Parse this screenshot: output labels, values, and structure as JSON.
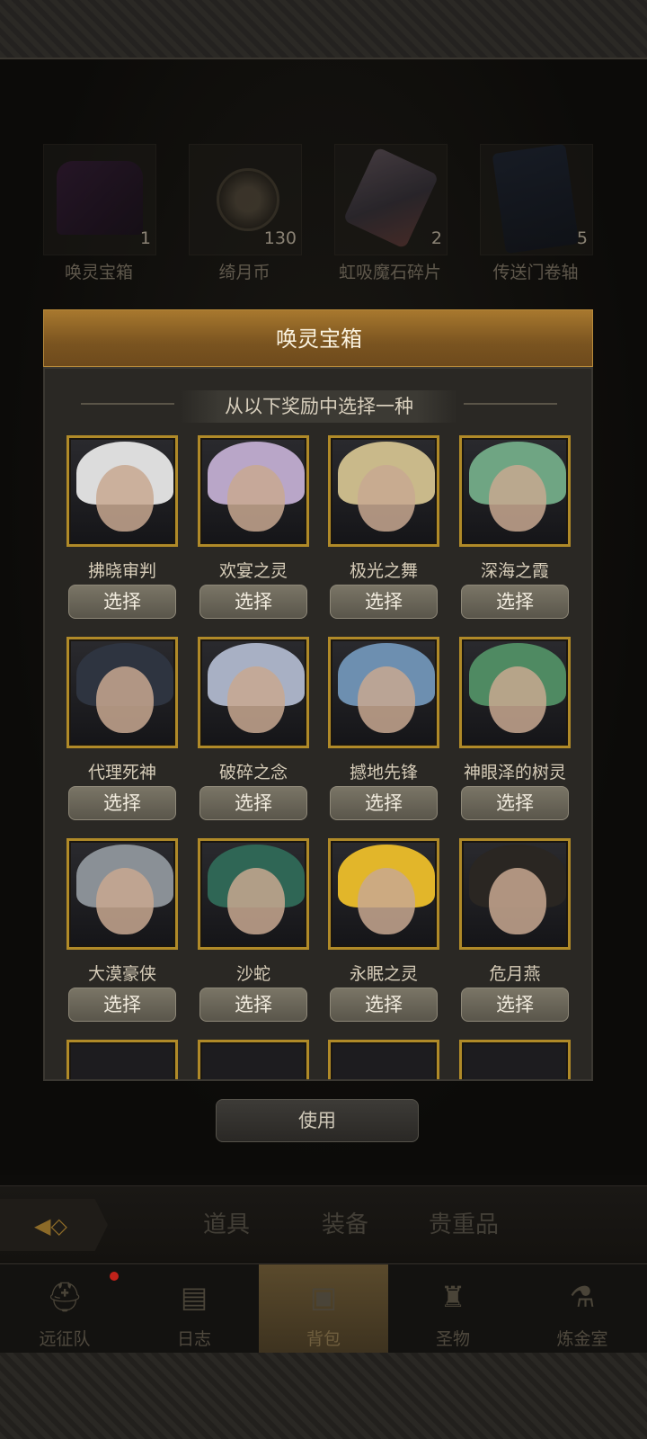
{
  "inventory": [
    {
      "name": "唤灵宝箱",
      "count": "1",
      "icon": "chest-icon"
    },
    {
      "name": "绮月币",
      "count": "130",
      "icon": "moon-coin-icon"
    },
    {
      "name": "虹吸魔石碎片",
      "count": "2",
      "icon": "crystal-icon"
    },
    {
      "name": "传送门卷轴",
      "count": "5",
      "icon": "scroll-icon"
    }
  ],
  "modal": {
    "title": "唤灵宝箱",
    "subtitle": "从以下奖励中选择一种",
    "select_label": "选择",
    "heroes": [
      {
        "name": "拂晓审判",
        "hair": "#dcdcdc"
      },
      {
        "name": "欢宴之灵",
        "hair": "#b9a6c8"
      },
      {
        "name": "极光之舞",
        "hair": "#c9b98a"
      },
      {
        "name": "深海之霞",
        "hair": "#6fa583"
      },
      {
        "name": "代理死神",
        "hair": "#2e3440"
      },
      {
        "name": "破碎之念",
        "hair": "#a8b0c4"
      },
      {
        "name": "撼地先锋",
        "hair": "#6d8fb0"
      },
      {
        "name": "神眼泽的树灵",
        "hair": "#4f8a62"
      },
      {
        "name": "大漠豪侠",
        "hair": "#8a9096"
      },
      {
        "name": "沙蛇",
        "hair": "#2f6655"
      },
      {
        "name": "永眠之灵",
        "hair": "#e2b62a"
      },
      {
        "name": "危月燕",
        "hair": "#2a2622"
      }
    ]
  },
  "use_button": "使用",
  "tabs": [
    "道具",
    "装备",
    "贵重品"
  ],
  "nav": [
    {
      "label": "远征队",
      "icon": "viking-helmet-icon"
    },
    {
      "label": "日志",
      "icon": "journal-icon"
    },
    {
      "label": "背包",
      "icon": "backpack-icon"
    },
    {
      "label": "圣物",
      "icon": "relic-icon"
    },
    {
      "label": "炼金室",
      "icon": "alchemy-icon"
    }
  ]
}
